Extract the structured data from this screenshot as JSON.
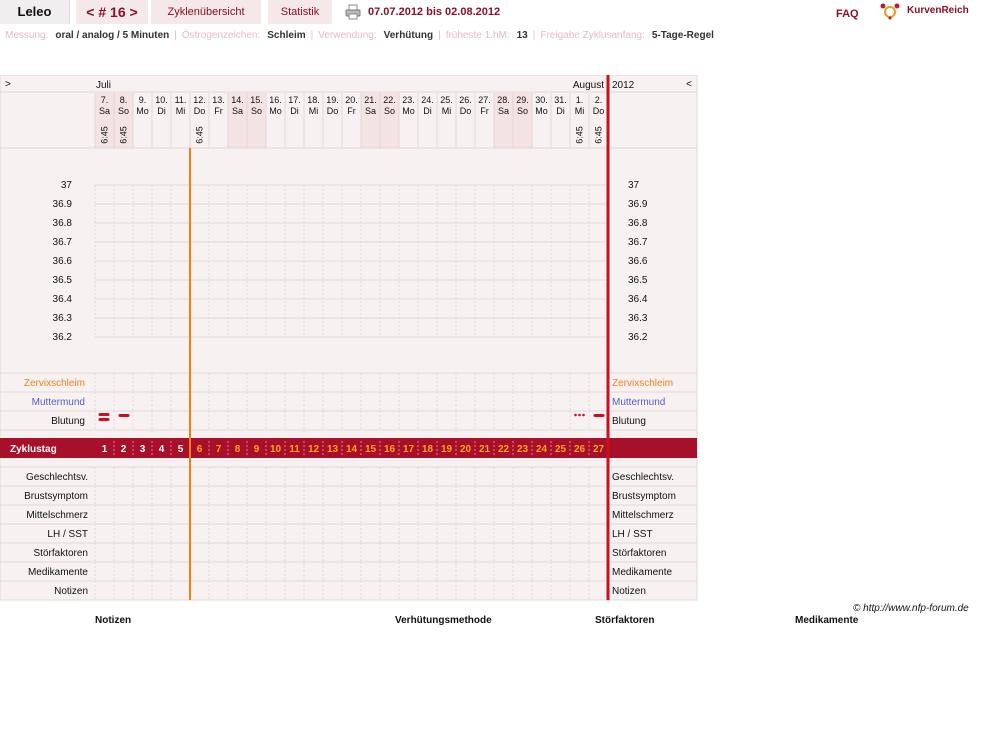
{
  "header": {
    "user": "Leleo",
    "cycle": "< # 16 >",
    "overview_tab": "Zyklenübersicht",
    "stats_tab": "Statistik",
    "date_range": "07.07.2012 bis 02.08.2012",
    "faq": "FAQ",
    "logo": "KurvenReich"
  },
  "settings": [
    {
      "label": "Messung:",
      "value": "oral / analog / 5 Minuten"
    },
    {
      "label": "Östrogenzeichen:",
      "value": "Schleim"
    },
    {
      "label": "Verwendung:",
      "value": "Verhütung"
    },
    {
      "label": "früheste 1.hM:",
      "value": "13"
    },
    {
      "label": "Freigabe Zyklusanfang:",
      "value": "5-Tage-Regel"
    }
  ],
  "chart": {
    "nav_left": ">",
    "nav_right": "<",
    "month_start": "Juli",
    "month_end": "August",
    "year": "2012",
    "days": [
      {
        "d": "7.",
        "w": "Sa",
        "weekend": true,
        "time": "6:45"
      },
      {
        "d": "8.",
        "w": "So",
        "weekend": true,
        "time": "6:45"
      },
      {
        "d": "9.",
        "w": "Mo",
        "weekend": false,
        "time": ""
      },
      {
        "d": "10.",
        "w": "Di",
        "weekend": false,
        "time": ""
      },
      {
        "d": "11.",
        "w": "Mi",
        "weekend": false,
        "time": ""
      },
      {
        "d": "12.",
        "w": "Do",
        "weekend": false,
        "time": "6:45"
      },
      {
        "d": "13.",
        "w": "Fr",
        "weekend": false,
        "time": ""
      },
      {
        "d": "14.",
        "w": "Sa",
        "weekend": true,
        "time": ""
      },
      {
        "d": "15.",
        "w": "So",
        "weekend": true,
        "time": ""
      },
      {
        "d": "16.",
        "w": "Mo",
        "weekend": false,
        "time": ""
      },
      {
        "d": "17.",
        "w": "Di",
        "weekend": false,
        "time": ""
      },
      {
        "d": "18.",
        "w": "Mi",
        "weekend": false,
        "time": ""
      },
      {
        "d": "19.",
        "w": "Do",
        "weekend": false,
        "time": ""
      },
      {
        "d": "20.",
        "w": "Fr",
        "weekend": false,
        "time": ""
      },
      {
        "d": "21.",
        "w": "Sa",
        "weekend": true,
        "time": ""
      },
      {
        "d": "22.",
        "w": "So",
        "weekend": true,
        "time": ""
      },
      {
        "d": "23.",
        "w": "Mo",
        "weekend": false,
        "time": ""
      },
      {
        "d": "24.",
        "w": "Di",
        "weekend": false,
        "time": ""
      },
      {
        "d": "25.",
        "w": "Mi",
        "weekend": false,
        "time": ""
      },
      {
        "d": "26.",
        "w": "Do",
        "weekend": false,
        "time": ""
      },
      {
        "d": "27.",
        "w": "Fr",
        "weekend": false,
        "time": ""
      },
      {
        "d": "28.",
        "w": "Sa",
        "weekend": true,
        "time": ""
      },
      {
        "d": "29.",
        "w": "So",
        "weekend": true,
        "time": ""
      },
      {
        "d": "30.",
        "w": "Mo",
        "weekend": false,
        "time": ""
      },
      {
        "d": "31.",
        "w": "Di",
        "weekend": false,
        "time": ""
      },
      {
        "d": "1.",
        "w": "Mi",
        "weekend": false,
        "time": "6:45"
      },
      {
        "d": "2.",
        "w": "Do",
        "weekend": false,
        "time": "6:45"
      }
    ],
    "temp_ticks": [
      "37",
      "36.9",
      "36.8",
      "36.7",
      "36.6",
      "36.5",
      "36.4",
      "36.3",
      "36.2"
    ],
    "row_zervix": "Zervixschleim",
    "row_mutter": "Muttermund",
    "row_blutung": "Blutung",
    "bleeding": [
      {
        "day": 1,
        "kind": "double"
      },
      {
        "day": 2,
        "kind": "single"
      },
      {
        "day": 26,
        "kind": "dots"
      },
      {
        "day": 27,
        "kind": "single"
      }
    ],
    "zyklustag_label": "Zyklustag",
    "cycle_days": [
      "1",
      "2",
      "3",
      "4",
      "5",
      "6",
      "7",
      "8",
      "9",
      "10",
      "11",
      "12",
      "13",
      "14",
      "15",
      "16",
      "17",
      "18",
      "19",
      "20",
      "21",
      "22",
      "23",
      "24",
      "25",
      "26",
      "27"
    ],
    "bottom_rows": [
      "Geschlechtsv.",
      "Brustsymptom",
      "Mittelschmerz",
      "LH / SST",
      "Störfaktoren",
      "Medikamente",
      "Notizen"
    ],
    "colors": {
      "accent": "#a8102a",
      "orange": "#f07f1a",
      "weekend": "#f4e3e3",
      "grid": "#e2d6d6",
      "bg": "#f8f1f1",
      "blue": "#5060c8"
    }
  },
  "copyright": "© http://www.nfp-forum.de",
  "footer": [
    "Notizen",
    "Verhütungsmethode",
    "Störfaktoren",
    "Medikamente"
  ]
}
